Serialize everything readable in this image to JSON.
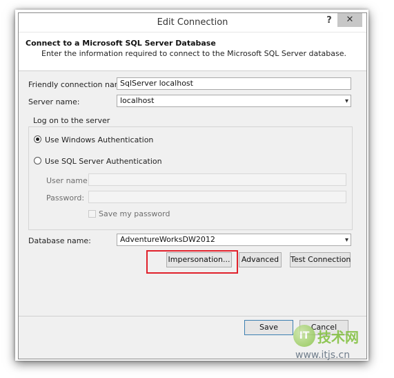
{
  "window": {
    "title": "Edit Connection",
    "help_label": "?",
    "close_label": "✕"
  },
  "header": {
    "title": "Connect to a Microsoft SQL Server Database",
    "subtitle": "Enter the information required to connect to the Microsoft SQL Server database."
  },
  "form": {
    "friendly_name_label": "Friendly connection name:",
    "friendly_name_value": "SqlServer localhost",
    "server_name_label": "Server name:",
    "server_name_value": "localhost",
    "logon_group_label": "Log on to the server",
    "windows_auth_label": "Use Windows Authentication",
    "sql_auth_label": "Use SQL Server Authentication",
    "selected_auth": "windows",
    "username_label": "User name:",
    "username_value": "",
    "password_label": "Password:",
    "password_value": "",
    "save_password_label": "Save my password",
    "save_password_checked": false,
    "database_name_label": "Database name:",
    "database_name_value": "AdventureWorksDW2012"
  },
  "buttons": {
    "impersonation": "Impersonation...",
    "advanced": "Advanced",
    "test_connection": "Test Connection",
    "save": "Save",
    "cancel": "Cancel"
  },
  "icons": {
    "dropdown": "▾"
  },
  "watermark": {
    "logo_text": "IT",
    "brand_text": "技术网",
    "url": "www.itjs.cn"
  },
  "colors": {
    "highlight": "#e0202a",
    "primary_button_border": "#3c7fb1"
  }
}
